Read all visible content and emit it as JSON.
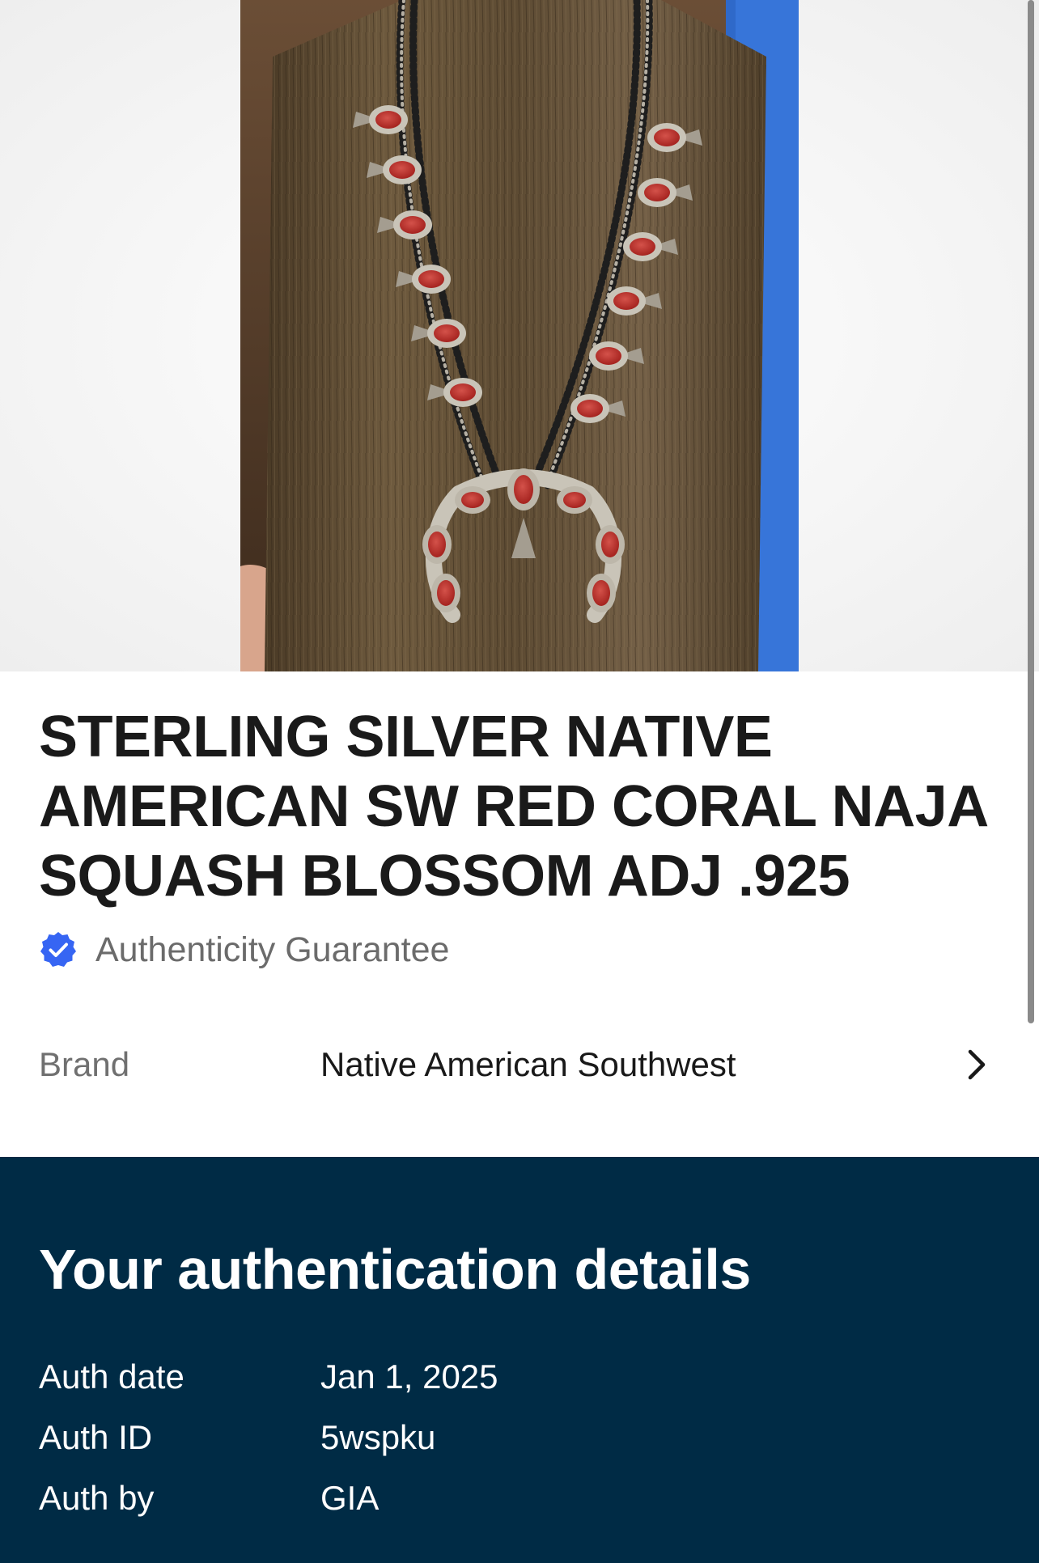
{
  "product": {
    "image_alt": "Sterling silver squash blossom necklace with red coral stones and naja pendant on a wooden display bust",
    "title": "STERLING SILVER NATIVE AMERICAN SW RED CORAL NAJA SQUASH BLOSSOM ADJ .925"
  },
  "authenticity": {
    "label": "Authenticity Guarantee",
    "icon": "verified-check-icon",
    "color": "#3665f3"
  },
  "specifics": {
    "brand_label": "Brand",
    "brand_value": "Native American Southwest",
    "chevron_icon": "chevron-right-icon"
  },
  "auth_details": {
    "heading": "Your authentication details",
    "background_color": "#002b45",
    "rows": [
      {
        "label": "Auth date",
        "value": "Jan 1, 2025"
      },
      {
        "label": "Auth ID",
        "value": "5wspku"
      },
      {
        "label": "Auth by",
        "value": "GIA"
      }
    ]
  }
}
